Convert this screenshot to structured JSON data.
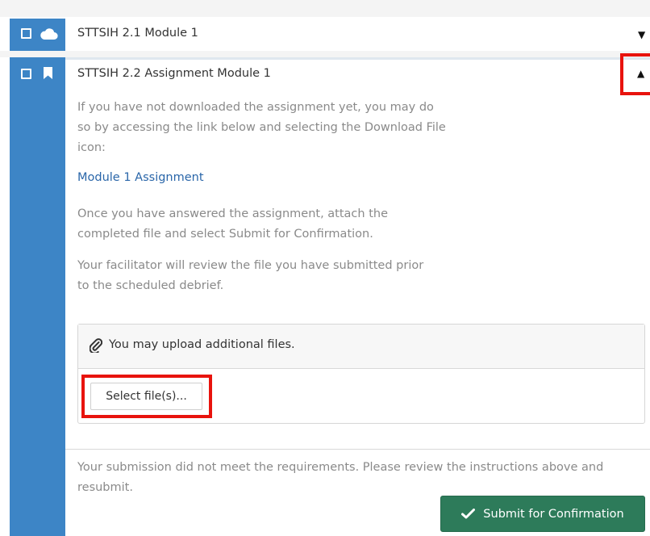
{
  "colors": {
    "rail": "#3d85c6",
    "link": "#2a66a9",
    "muted_text": "#8a8a8a",
    "highlight": "#e8130d",
    "submit": "#2d7b5a"
  },
  "items": [
    {
      "title": "STTSIH 2.1 Module 1",
      "type_icon": "cloud-icon",
      "toggle_icon": "caret-down-icon"
    },
    {
      "title": "STTSIH 2.2 Assignment Module 1",
      "type_icon": "bookmark-icon",
      "toggle_icon": "caret-up-icon",
      "instructions": [
        "If you have not downloaded the assignment yet, you may do so by accessing the link below and selecting the Download File icon:",
        "Once you have answered the assignment, attach the completed file and select Submit for Confirmation.",
        "Your facilitator will review the file you have submitted prior to the scheduled debrief."
      ],
      "assignment_link": "Module 1 Assignment",
      "upload": {
        "icon": "paperclip-icon",
        "text": "You may upload additional files.",
        "select_label": "Select file(s)..."
      },
      "status_message": "Your submission did not meet the requirements. Please review the instructions above and resubmit.",
      "submit_label": "Submit for Confirmation",
      "submit_icon": "checkmark-icon"
    }
  ]
}
